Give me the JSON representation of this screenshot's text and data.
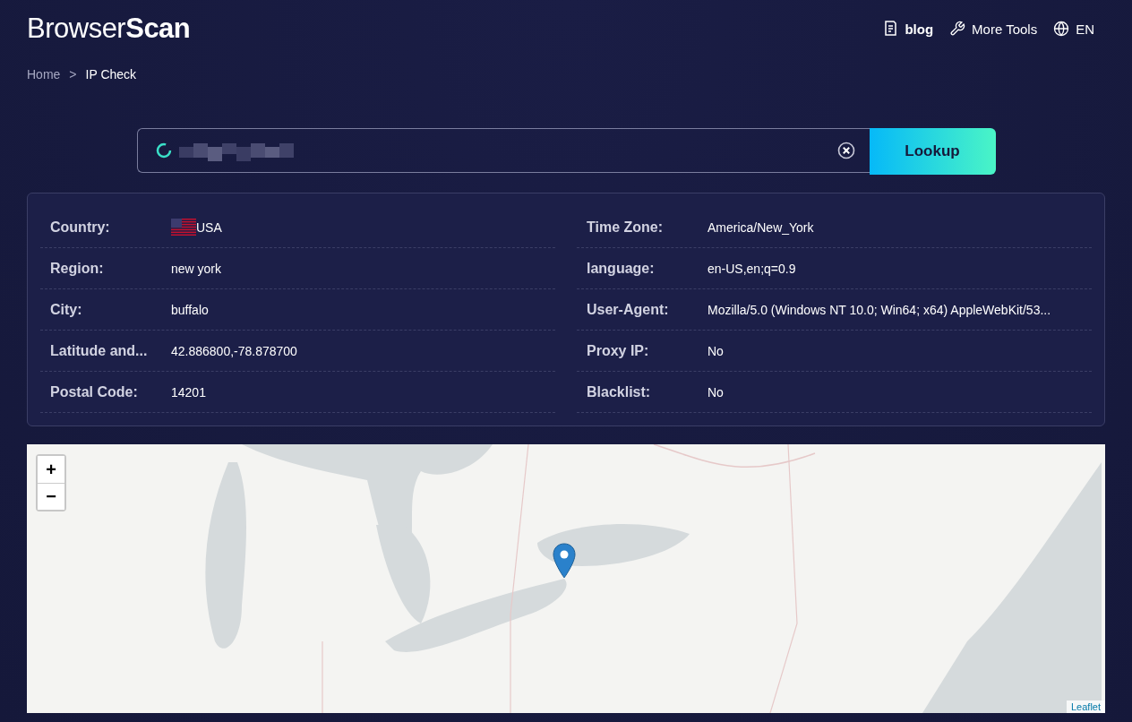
{
  "header": {
    "logo": {
      "light": "Browser",
      "bold": "Scan"
    },
    "nav": [
      {
        "kind": "blog",
        "label": "blog"
      },
      {
        "kind": "tools",
        "label": "More Tools"
      },
      {
        "kind": "lang",
        "label": "EN"
      }
    ]
  },
  "breadcrumb": [
    "Home",
    ">",
    "IP Check"
  ],
  "search": {
    "button": "Lookup",
    "loading": true
  },
  "info": {
    "columns": [
      [
        {
          "label": "Country:",
          "value": "USA",
          "flag": true
        },
        {
          "label": "Region:",
          "value": "new york"
        },
        {
          "label": "City:",
          "value": "buffalo"
        },
        {
          "label": "Latitude and...",
          "value": "42.886800,-78.878700"
        },
        {
          "label": "Postal Code:",
          "value": "14201"
        }
      ],
      [
        {
          "label": "Time Zone:",
          "value": "America/New_York"
        },
        {
          "label": "language:",
          "value": "en-US,en;q=0.9"
        },
        {
          "label": "User-Agent:",
          "value": "Mozilla/5.0 (Windows NT 10.0; Win64; x64) AppleWebKit/53..."
        },
        {
          "label": "Proxy IP:",
          "value": "No"
        },
        {
          "label": "Blacklist:",
          "value": "No"
        }
      ]
    ]
  },
  "map": {
    "zoom_in": "+",
    "zoom_out": "−",
    "attribution": "Leaflet"
  }
}
